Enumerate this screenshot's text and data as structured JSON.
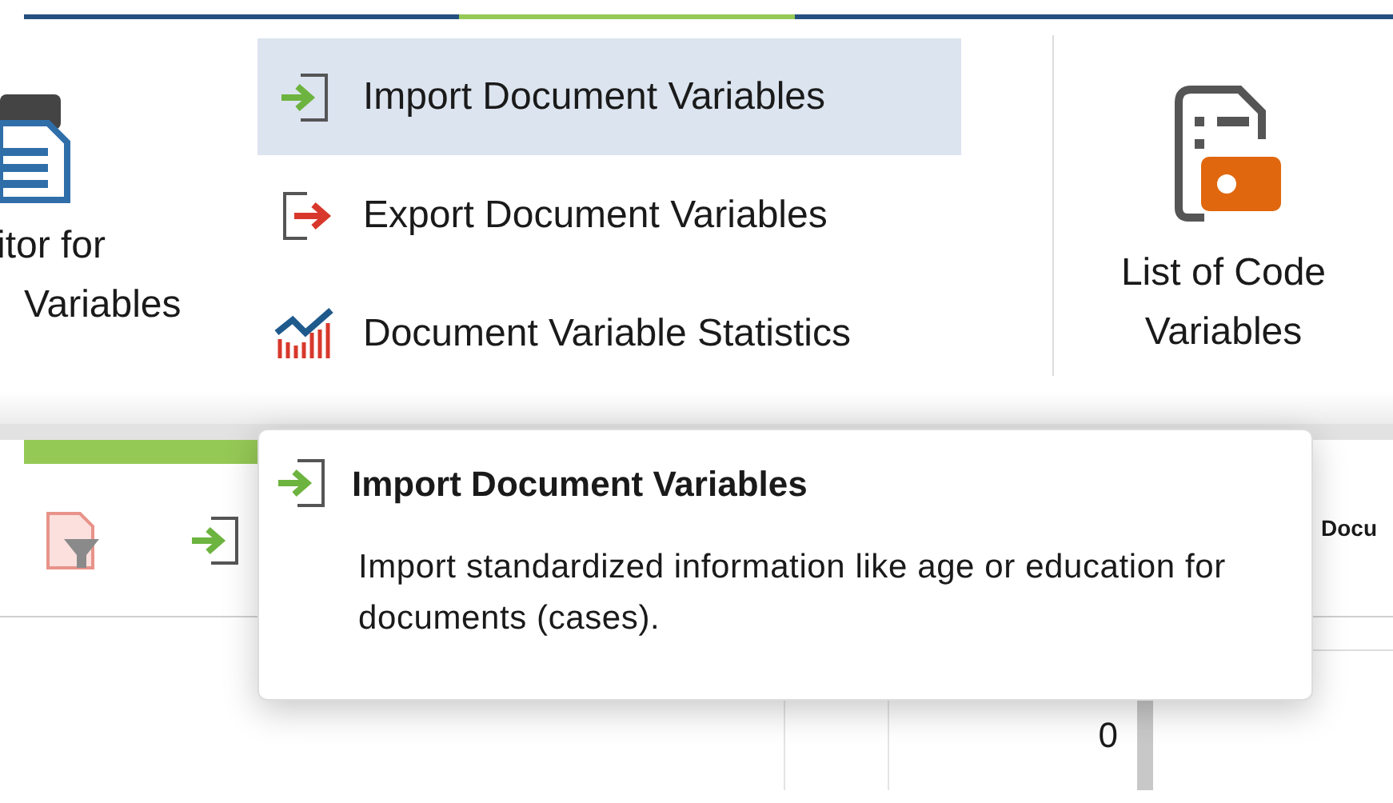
{
  "ribbon": {
    "left_button": {
      "lines": [
        "itor for",
        "Variables"
      ]
    },
    "menu_items": [
      {
        "kind": "import",
        "label": "Import Document Variables",
        "selected": true
      },
      {
        "kind": "export",
        "label": "Export Document Variables",
        "selected": false
      },
      {
        "kind": "statistics",
        "label": "Document Variable Statistics",
        "selected": false
      }
    ],
    "right_button": {
      "lines": [
        "List of Code",
        "Variables"
      ]
    }
  },
  "toolbar": {
    "partial_label": "Docu"
  },
  "table": {
    "cells": [
      "0"
    ]
  },
  "tooltip": {
    "kind": "import",
    "title": "Import Document Variables",
    "description": "Import standardized information like age or education for documents (cases)."
  }
}
